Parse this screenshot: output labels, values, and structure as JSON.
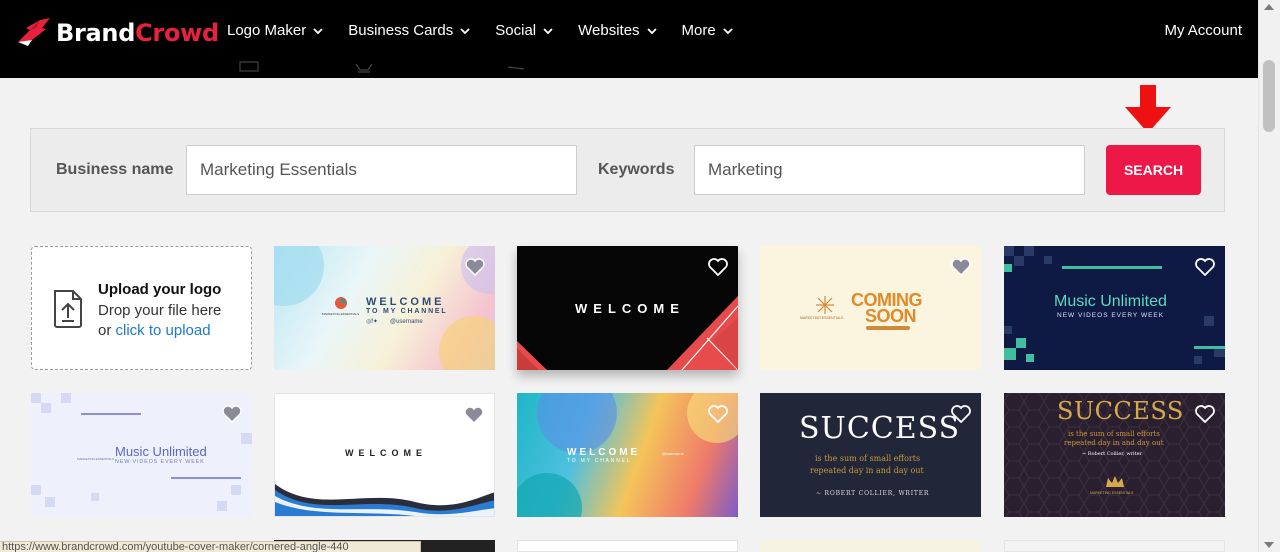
{
  "brand": {
    "part1": "Brand",
    "part2": "Crowd"
  },
  "nav": {
    "items": [
      "Logo Maker",
      "Business Cards",
      "Social",
      "Websites",
      "More"
    ],
    "account": "My Account"
  },
  "search": {
    "business_label": "Business name",
    "business_value": "Marketing Essentials",
    "keywords_label": "Keywords",
    "keywords_value": "Marketing",
    "button": "SEARCH"
  },
  "upload": {
    "title": "Upload your logo",
    "line2": "Drop your file here",
    "line3_prefix": "or ",
    "link": "click to upload"
  },
  "templates": {
    "t1": {
      "line1": "WELCOME",
      "line2": "TO MY CHANNEL",
      "handle": "@username",
      "brand": "MARKETING ESSENTIALS"
    },
    "t2": {
      "line1": "WELCOME"
    },
    "t3": {
      "line1": "COMING",
      "line2": "SOON",
      "brand": "MARKETING ESSENTIALS"
    },
    "t4": {
      "line1": "Music Unlimited",
      "line2": "NEW VIDEOS EVERY WEEK"
    },
    "t5": {
      "line1": "Music Unlimited",
      "line2": "NEW VIDEOS EVERY WEEK",
      "brand": "MARKETING ESSENTIALS"
    },
    "t6": {
      "line1": "WELCOME"
    },
    "t7": {
      "line1": "WELCOME",
      "line2": "TO MY CHANNEL",
      "handle": "@username"
    },
    "t8": {
      "line1": "SUCCESS",
      "line2": "is the sum of small efforts",
      "line3": "repeated day in and day out",
      "author": "~ ROBERT COLLIER, WRITER"
    },
    "t9": {
      "line1": "SUCCESS",
      "line2": "is the sum of small efforts",
      "line3": "repeated day in and day out",
      "author": "~ Robert Collier, writer",
      "brand": "MARKETING ESSENTIALS"
    }
  },
  "status_url": "https://www.brandcrowd.com/youtube-cover-maker/cornered-angle-440",
  "colors": {
    "accent": "#ee1848",
    "nav_bg": "#000000",
    "link": "#1b7ac9"
  }
}
